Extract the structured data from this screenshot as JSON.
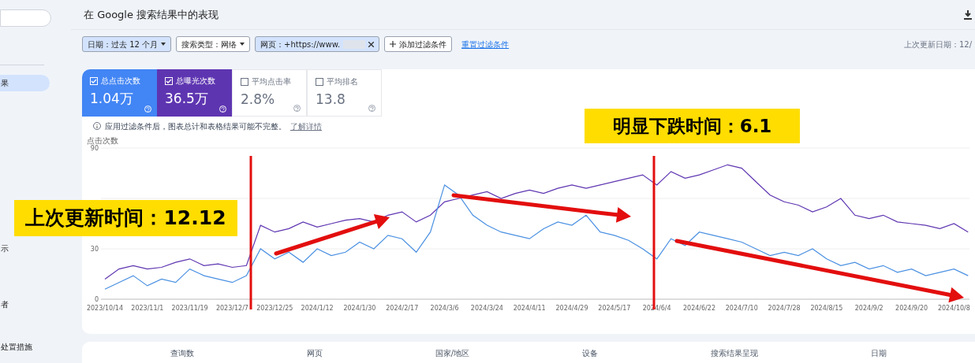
{
  "sidebar": {
    "items": [
      {
        "label": "果",
        "selected": true
      },
      {
        "label": "示",
        "selected": false
      },
      {
        "label": "者",
        "selected": false
      },
      {
        "label": "处置措施",
        "selected": false
      }
    ]
  },
  "header": {
    "title": "在 Google 搜索结果中的表现"
  },
  "filters": [
    {
      "label": "日期：过去 12 个月",
      "kind": "dropdown",
      "active": true
    },
    {
      "label": "搜索类型：网络",
      "kind": "dropdown",
      "active": false
    },
    {
      "label": "网页：+https://www.",
      "kind": "removable",
      "active": true
    },
    {
      "label": "添加过滤条件",
      "kind": "add",
      "active": false
    }
  ],
  "reset_link": "重置过滤条件",
  "last_updated": "上次更新日期：12/",
  "metrics": [
    {
      "label": "总点击次数",
      "value": "1.04万",
      "selected": true,
      "color": "#4285f4"
    },
    {
      "label": "总曝光次数",
      "value": "36.5万",
      "selected": true,
      "color": "#5e35b1"
    },
    {
      "label": "平均点击率",
      "value": "2.8%",
      "selected": false
    },
    {
      "label": "平均排名",
      "value": "13.8",
      "selected": false
    }
  ],
  "notice": {
    "text": "应用过滤条件后，图表总计和表格结果可能不完整。",
    "link": "了解详情"
  },
  "chart": {
    "chart_data": {
      "type": "line",
      "ylabel": "点击次数",
      "ylim": [
        0,
        90
      ],
      "yticks": [
        0,
        30,
        90
      ],
      "categories": [
        "2023/10/14",
        null,
        null,
        "2023/11/1",
        null,
        null,
        "2023/11/19",
        null,
        null,
        "2023/12/7",
        null,
        null,
        "2023/12/25",
        null,
        null,
        "2024/1/12",
        null,
        null,
        "2024/1/30",
        null,
        null,
        "2024/2/17",
        null,
        null,
        "2024/3/6",
        null,
        null,
        "2024/3/24",
        null,
        null,
        "2024/4/11",
        null,
        null,
        "2024/4/29",
        null,
        null,
        "2024/5/17",
        null,
        null,
        "2024/6/4",
        null,
        null,
        "2024/6/22",
        null,
        null,
        "2024/7/10",
        null,
        null,
        "2024/7/28",
        null,
        null,
        "2024/8/15",
        null,
        null,
        "2024/9/2",
        null,
        null,
        "2024/9/20",
        null,
        null,
        "2024/10/8",
        null
      ],
      "series": [
        {
          "color": "#5e35b1",
          "values": [
            12,
            18,
            20,
            18,
            19,
            22,
            24,
            20,
            21,
            19,
            20,
            44,
            40,
            42,
            46,
            43,
            45,
            47,
            48,
            46,
            50,
            52,
            46,
            50,
            58,
            60,
            62,
            64,
            60,
            63,
            65,
            63,
            66,
            68,
            66,
            68,
            70,
            72,
            74,
            68,
            76,
            72,
            74,
            77,
            80,
            78,
            70,
            62,
            58,
            56,
            52,
            55,
            60,
            50,
            48,
            50,
            46,
            45,
            44,
            42,
            45,
            40
          ]
        },
        {
          "color": "#4a90e2",
          "values": [
            6,
            10,
            14,
            8,
            12,
            10,
            18,
            14,
            12,
            10,
            14,
            30,
            24,
            28,
            22,
            30,
            26,
            28,
            34,
            30,
            38,
            36,
            28,
            40,
            68,
            62,
            50,
            44,
            40,
            38,
            36,
            42,
            46,
            44,
            50,
            40,
            38,
            35,
            30,
            24,
            36,
            32,
            40,
            38,
            36,
            34,
            30,
            26,
            28,
            26,
            30,
            24,
            20,
            22,
            18,
            20,
            16,
            18,
            14,
            16,
            18,
            14
          ]
        }
      ]
    }
  },
  "annotations": [
    {
      "text": "上次更新时间：12.12"
    },
    {
      "text": "明显下跌时间：6.1"
    }
  ],
  "bottom_tabs": [
    "查询数",
    "网页",
    "国家/地区",
    "设备",
    "搜索结果呈现",
    "日期"
  ]
}
